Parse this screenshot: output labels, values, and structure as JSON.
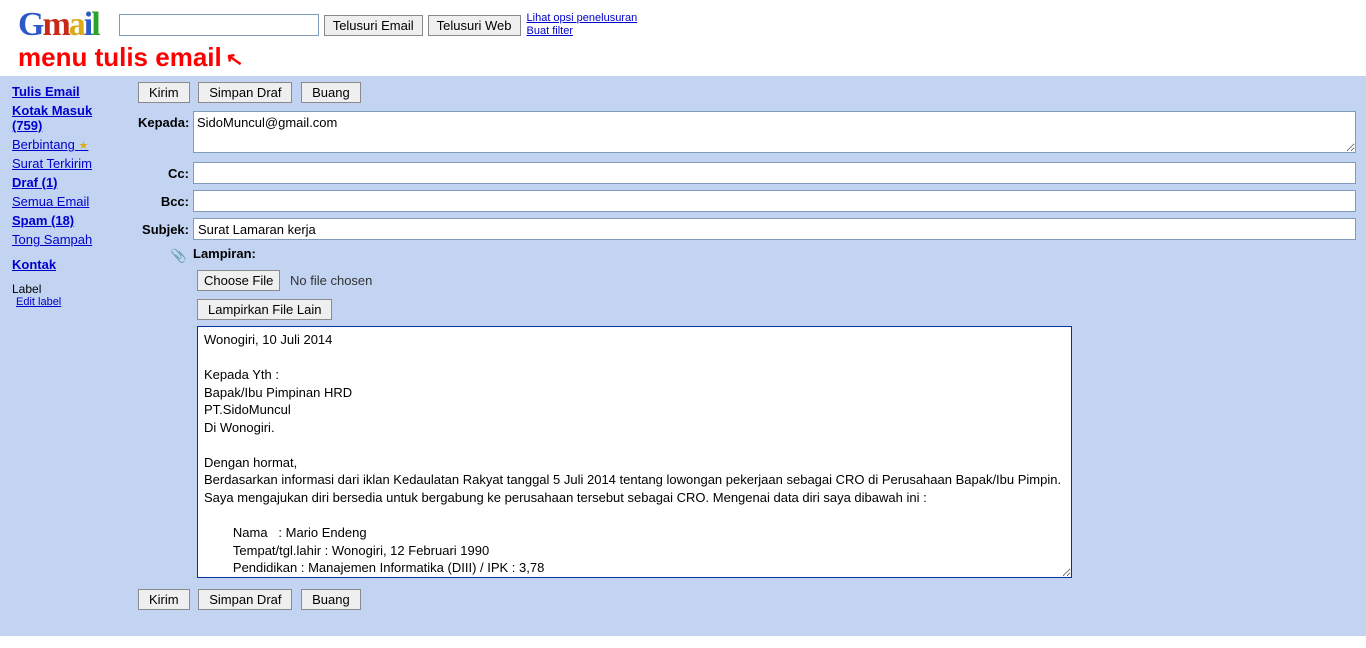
{
  "header": {
    "logo_text": "Gmail",
    "search_value": "",
    "btn_search_mail": "Telusuri Email",
    "btn_search_web": "Telusuri Web",
    "link_search_options": "Lihat opsi penelusuran",
    "link_create_filter": "Buat filter"
  },
  "annotation": "menu tulis email",
  "sidebar": {
    "compose": "Tulis Email",
    "inbox": "Kotak Masuk (759)",
    "starred": "Berbintang",
    "sent": "Surat Terkirim",
    "drafts": "Draf (1)",
    "all": "Semua Email",
    "spam": "Spam (18)",
    "trash": "Tong Sampah",
    "contacts": "Kontak",
    "label_heading": "Label",
    "edit_label": "Edit label"
  },
  "toolbar": {
    "send": "Kirim",
    "save_draft": "Simpan Draf",
    "discard": "Buang"
  },
  "compose": {
    "to_label": "Kepada:",
    "to_value": "SidoMuncul@gmail.com",
    "cc_label": "Cc:",
    "cc_value": "",
    "bcc_label": "Bcc:",
    "bcc_value": "",
    "subject_label": "Subjek:",
    "subject_value": "Surat Lamaran kerja",
    "attach_label": "Lampiran:",
    "choose_file": "Choose File",
    "no_file": "No file chosen",
    "attach_more": "Lampirkan File Lain",
    "body": "Wonogiri, 10 Juli 2014\n\nKepada Yth :\nBapak/Ibu Pimpinan HRD\nPT.SidoMuncul\nDi Wonogiri.\n\nDengan hormat,\nBerdasarkan informasi dari iklan Kedaulatan Rakyat tanggal 5 Juli 2014 tentang lowongan pekerjaan sebagai CRO di Perusahaan Bapak/Ibu Pimpin. Saya mengajukan diri bersedia untuk bergabung ke perusahaan tersebut sebagai CRO. Mengenai data diri saya dibawah ini :\n\n        Nama   : Mario Endeng\n        Tempat/tgl.lahir : Wonogiri, 12 Februari 1990\n        Pendidikan : Manajemen Informatika (DIII) / IPK : 3,78"
  }
}
